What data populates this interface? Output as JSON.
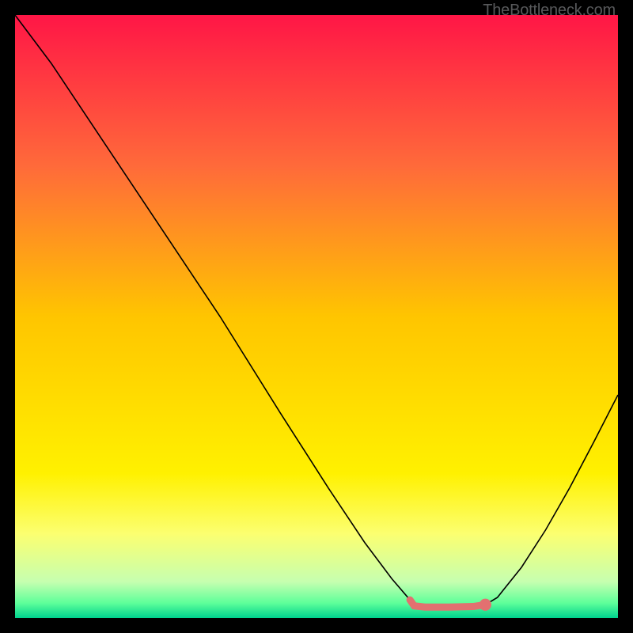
{
  "watermark": "TheBottleneck.com",
  "chart_data": {
    "type": "line",
    "title": "",
    "xlabel": "",
    "ylabel": "",
    "xlim": [
      0,
      100
    ],
    "ylim": [
      0,
      100
    ],
    "grid": false,
    "background": {
      "type": "vertical_gradient",
      "stops": [
        {
          "pos": 0.0,
          "color": "#ff1646"
        },
        {
          "pos": 0.25,
          "color": "#ff6a3a"
        },
        {
          "pos": 0.5,
          "color": "#ffc500"
        },
        {
          "pos": 0.76,
          "color": "#fff100"
        },
        {
          "pos": 0.86,
          "color": "#fcff70"
        },
        {
          "pos": 0.94,
          "color": "#c6ffb0"
        },
        {
          "pos": 0.975,
          "color": "#5fff9a"
        },
        {
          "pos": 1.0,
          "color": "#00d38e"
        }
      ]
    },
    "series": [
      {
        "name": "curve",
        "stroke": "#000000",
        "stroke_width": 1.6,
        "points": [
          {
            "x": 0.0,
            "y": 100.0
          },
          {
            "x": 6.0,
            "y": 92.0
          },
          {
            "x": 14.0,
            "y": 80.0
          },
          {
            "x": 24.0,
            "y": 65.0
          },
          {
            "x": 34.0,
            "y": 50.0
          },
          {
            "x": 44.0,
            "y": 34.0
          },
          {
            "x": 52.0,
            "y": 21.5
          },
          {
            "x": 58.0,
            "y": 12.5
          },
          {
            "x": 62.5,
            "y": 6.5
          },
          {
            "x": 65.5,
            "y": 3.0
          },
          {
            "x": 67.0,
            "y": 2.0
          },
          {
            "x": 70.0,
            "y": 1.8
          },
          {
            "x": 73.0,
            "y": 1.8
          },
          {
            "x": 76.0,
            "y": 1.9
          },
          {
            "x": 78.0,
            "y": 2.2
          },
          {
            "x": 80.0,
            "y": 3.4
          },
          {
            "x": 84.0,
            "y": 8.4
          },
          {
            "x": 88.0,
            "y": 14.6
          },
          {
            "x": 92.0,
            "y": 21.6
          },
          {
            "x": 96.0,
            "y": 29.2
          },
          {
            "x": 100.0,
            "y": 37.0
          }
        ]
      },
      {
        "name": "optimal_band",
        "stroke": "#e27070",
        "stroke_width": 9,
        "linecap": "round",
        "points": [
          {
            "x": 65.5,
            "y": 3.0
          },
          {
            "x": 66.2,
            "y": 2.0
          },
          {
            "x": 68.0,
            "y": 1.8
          },
          {
            "x": 72.0,
            "y": 1.8
          },
          {
            "x": 76.0,
            "y": 1.9
          },
          {
            "x": 78.0,
            "y": 2.2
          }
        ]
      },
      {
        "name": "endpoint_marker",
        "type": "circle",
        "fill": "#e27070",
        "cx": 78.0,
        "cy": 2.2,
        "r": 1.0
      }
    ]
  }
}
